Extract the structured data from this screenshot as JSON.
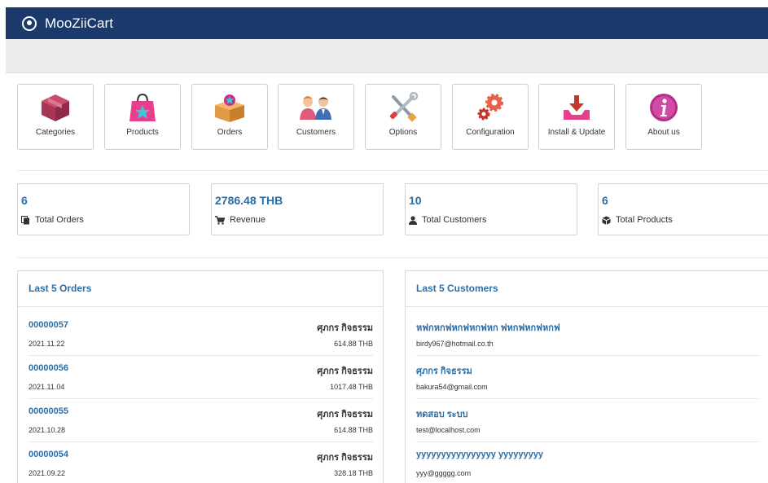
{
  "header": {
    "title": "MooZiiCart",
    "logo_icon": "radio-circle-icon",
    "bg_color": "#1b3a6b"
  },
  "tiles": [
    {
      "label": "Categories",
      "icon": "box-icon"
    },
    {
      "label": "Products",
      "icon": "shopping-bag-icon"
    },
    {
      "label": "Orders",
      "icon": "gift-box-icon"
    },
    {
      "label": "Customers",
      "icon": "people-icon"
    },
    {
      "label": "Options",
      "icon": "tools-icon"
    },
    {
      "label": "Configuration",
      "icon": "gears-icon"
    },
    {
      "label": "Install & Update",
      "icon": "download-tray-icon"
    },
    {
      "label": "About us",
      "icon": "info-icon"
    }
  ],
  "stats": [
    {
      "value": "6",
      "label": "Total Orders",
      "icon": "copy-icon"
    },
    {
      "value": "2786.48 THB",
      "label": "Revenue",
      "icon": "cart-icon"
    },
    {
      "value": "10",
      "label": "Total Customers",
      "icon": "user-icon"
    },
    {
      "value": "6",
      "label": "Total Products",
      "icon": "cube-icon"
    }
  ],
  "orders_panel": {
    "title": "Last 5 Orders",
    "rows": [
      {
        "id": "00000057",
        "customer": "ศุภกร กิจธรรม",
        "date": "2021.11.22",
        "total": "614.88 THB"
      },
      {
        "id": "00000056",
        "customer": "ศุภกร กิจธรรม",
        "date": "2021.11.04",
        "total": "1017.48 THB"
      },
      {
        "id": "00000055",
        "customer": "ศุภกร กิจธรรม",
        "date": "2021.10.28",
        "total": "614.88 THB"
      },
      {
        "id": "00000054",
        "customer": "ศุภกร กิจธรรม",
        "date": "2021.09.22",
        "total": "328.18 THB"
      }
    ]
  },
  "customers_panel": {
    "title": "Last 5 Customers",
    "rows": [
      {
        "name": "หฟกหกฟหกฟหกฟหก ฟหกฟหกฟหกฟ",
        "email": "birdy967@hotmail.co.th"
      },
      {
        "name": "ศุภกร กิจธรรม",
        "email": "bakura54@gmail.com"
      },
      {
        "name": "ทดสอบ ระบบ",
        "email": "test@localhost.com"
      },
      {
        "name": "yyyyyyyyyyyyyyyy yyyyyyyyy",
        "email": "yyy@ggggg.com"
      }
    ]
  }
}
